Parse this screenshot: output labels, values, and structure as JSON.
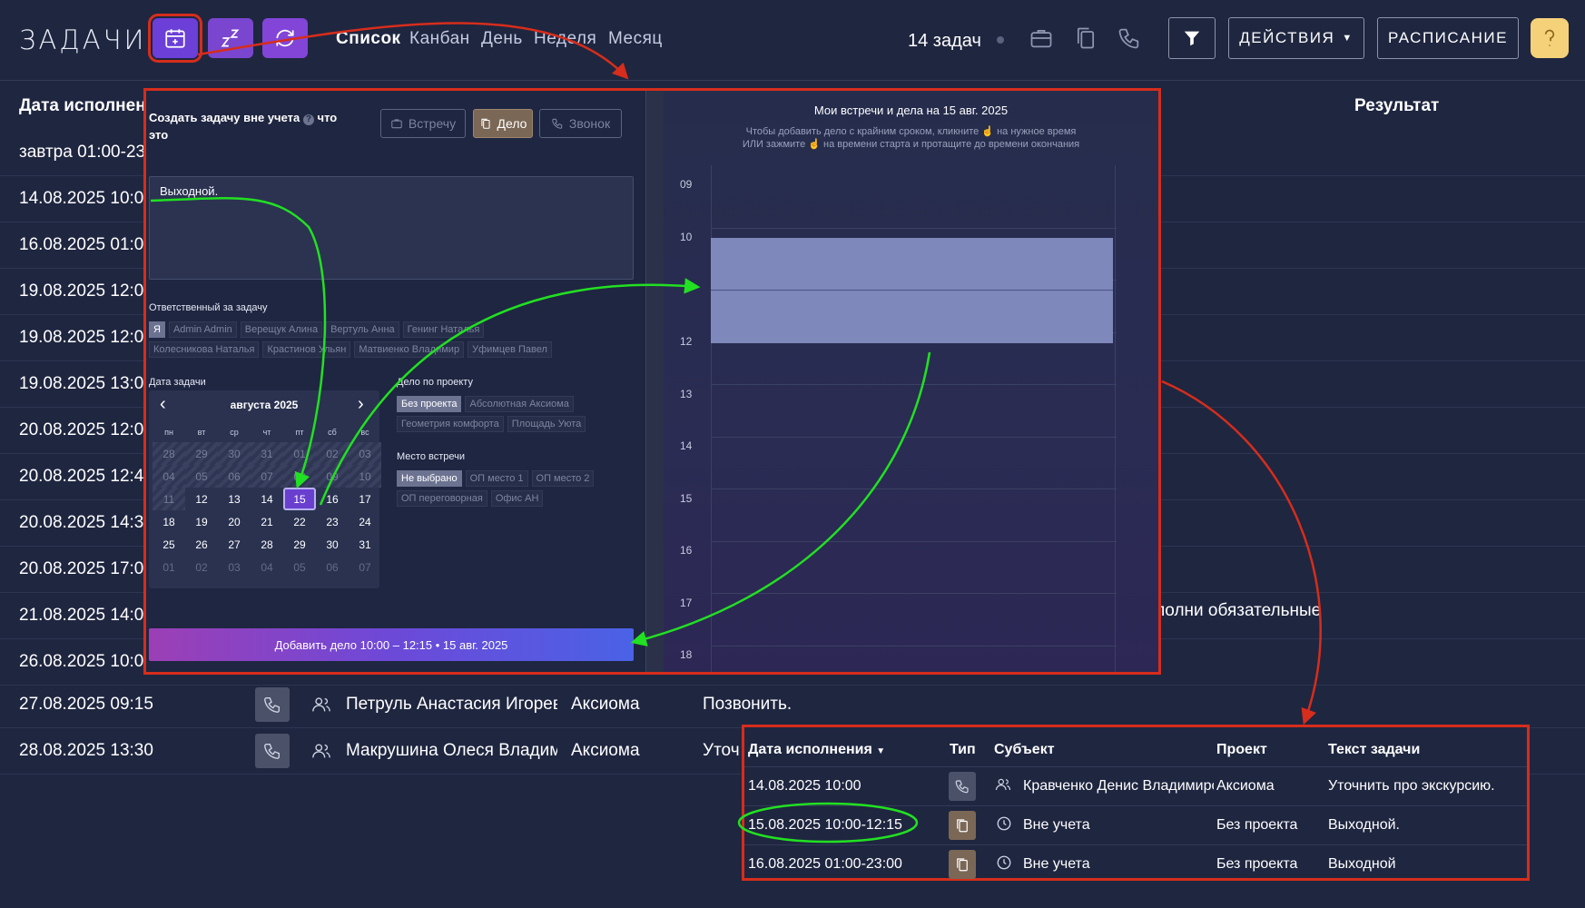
{
  "header": {
    "title": "ЗАДАЧИ",
    "view_tabs": [
      "Список",
      "Канбан",
      "День",
      "Неделя",
      "Месяц"
    ],
    "task_count": "14 задач",
    "actions_label": "ДЕЙСТВИЯ",
    "schedule_label": "РАСПИСАНИЕ"
  },
  "bg_table": {
    "col_date": "Дата исполнения",
    "col_result": "Результат",
    "rows": [
      {
        "date": "завтра 01:00-23"
      },
      {
        "date": "14.08.2025 10:0"
      },
      {
        "date": "16.08.2025 01:0"
      },
      {
        "date": "19.08.2025 12:0"
      },
      {
        "date": "19.08.2025 12:0"
      },
      {
        "date": "19.08.2025 13:0"
      },
      {
        "date": "20.08.2025 12:0"
      },
      {
        "date": "20.08.2025 12:4"
      },
      {
        "date": "20.08.2025 14:3"
      },
      {
        "date": "20.08.2025 17:0"
      },
      {
        "date": "21.08.2025 14:0"
      },
      {
        "date": "26.08.2025 10:0"
      },
      {
        "date": "27.08.2025 09:15",
        "subject": "Петруль Анастасия Игоревна",
        "project": "Аксиома",
        "text": "Позвонить."
      },
      {
        "date": "28.08.2025 13:30",
        "subject": "Макрушина Олеся Владимировна",
        "project": "Аксиома",
        "text": "Уточ"
      }
    ],
    "result_fragment": "полни обязательные"
  },
  "form": {
    "title": "Создать задачу вне учета",
    "help_text": "что это",
    "type_buttons": [
      "Встречу",
      "Дело",
      "Звонок"
    ],
    "text_value": "Выходной.",
    "responsible_label": "Ответственный за задачу",
    "responsible": [
      "Я",
      "Admin Admin",
      "Верещук Алина",
      "Вертуль Анна",
      "Генинг Наталья",
      "Колесникова Наталья",
      "Крастинов Ульян",
      "Матвиенко Владимир",
      "Уфимцев Павел"
    ],
    "date_label": "Дата задачи",
    "calendar": {
      "month": "августа 2025",
      "dow": [
        "пн",
        "вт",
        "ср",
        "чт",
        "пт",
        "сб",
        "вс"
      ],
      "weeks": [
        [
          "28",
          "29",
          "30",
          "31",
          "01",
          "02",
          "03"
        ],
        [
          "04",
          "05",
          "06",
          "07",
          "08",
          "09",
          "10"
        ],
        [
          "11",
          "12",
          "13",
          "14",
          "15",
          "16",
          "17"
        ],
        [
          "18",
          "19",
          "20",
          "21",
          "22",
          "23",
          "24"
        ],
        [
          "25",
          "26",
          "27",
          "28",
          "29",
          "30",
          "31"
        ],
        [
          "01",
          "02",
          "03",
          "04",
          "05",
          "06",
          "07"
        ]
      ],
      "selected": "15"
    },
    "project_label": "Дело по проекту",
    "projects": [
      "Без проекта",
      "Абсолютная Аксиома",
      "Геометрия комфорта",
      "Площадь Уюта"
    ],
    "place_label": "Место встречи",
    "places": [
      "Не выбрано",
      "ОП место 1",
      "ОП место 2",
      "ОП переговорная",
      "Офис АН"
    ],
    "submit_label": "Добавить дело 10:00 – 12:15 • 15 авг. 2025"
  },
  "schedule": {
    "title": "Мои встречи и дела на 15 авг. 2025",
    "hint_line1": "Чтобы добавить дело с крайним сроком, кликните ☝ на нужное время",
    "hint_line2": "ИЛИ зажмите ☝ на времени старта и протащите до времени окончания",
    "hours": [
      "09",
      "10",
      "",
      "12",
      "13",
      "14",
      "15",
      "16",
      "17",
      "18"
    ]
  },
  "result_table": {
    "headers": [
      "Дата исполнения",
      "Тип",
      "Субъект",
      "Проект",
      "Текст задачи"
    ],
    "rows": [
      {
        "date": "14.08.2025 10:00",
        "subject": "Кравченко Денис Владимирович",
        "project": "Аксиома",
        "text": "Уточнить про экскурсию."
      },
      {
        "date": "15.08.2025 10:00-12:15",
        "subject": "Вне учета",
        "project": "Без проекта",
        "text": "Выходной."
      },
      {
        "date": "16.08.2025 01:00-23:00",
        "subject": "Вне учета",
        "project": "Без проекта",
        "text": "Выходной"
      }
    ]
  },
  "colors": {
    "accent": "#6b3fd8",
    "highlight_red": "#d62d1c",
    "highlight_green": "#22e022",
    "event_block": "#7f88bb"
  }
}
